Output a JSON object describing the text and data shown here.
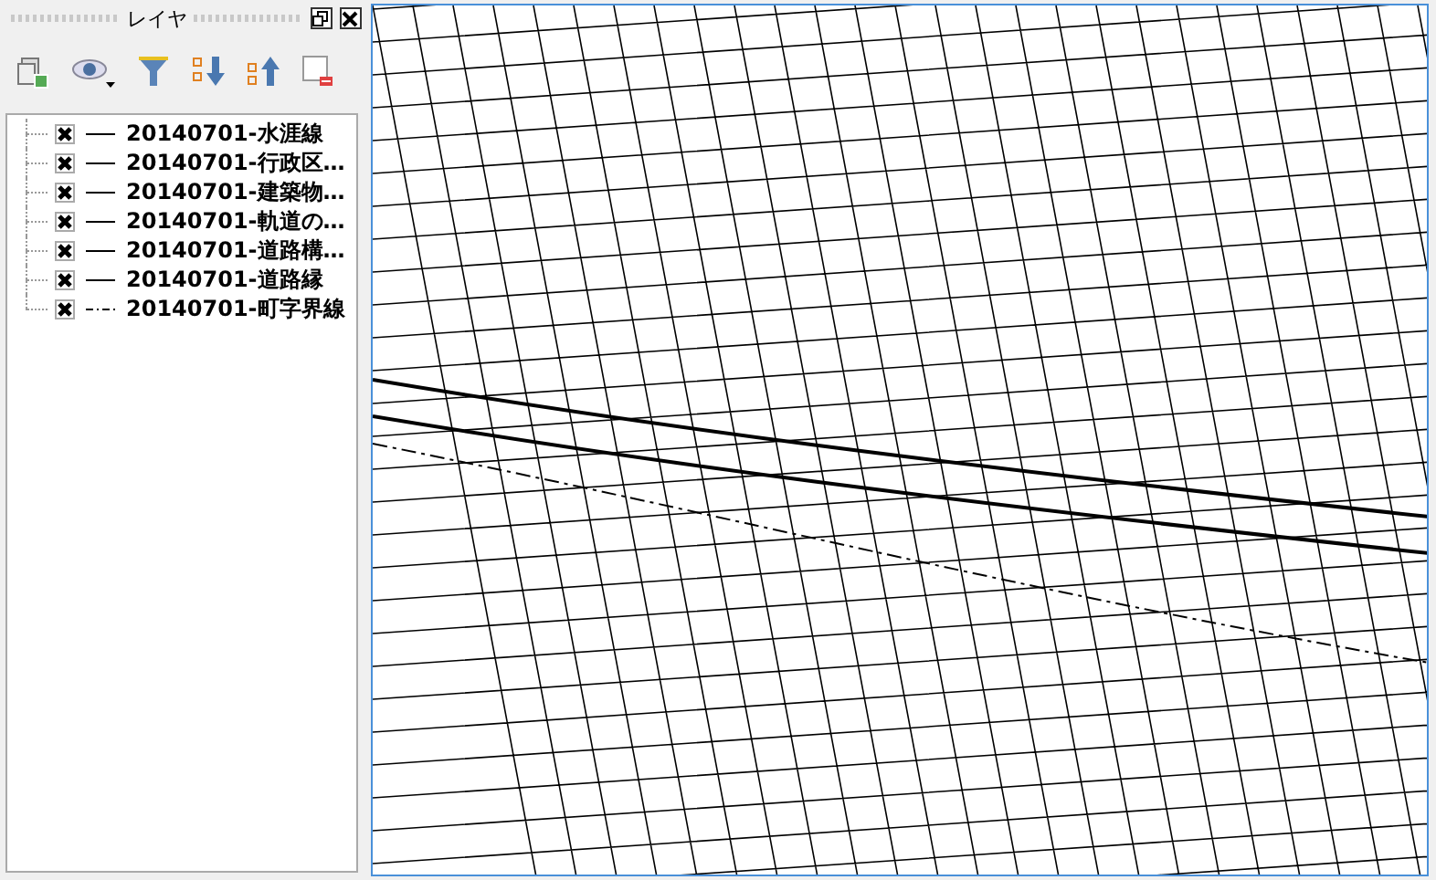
{
  "panel": {
    "title": "レイヤ"
  },
  "layers": [
    {
      "name": "20140701-水涯線",
      "checked": true,
      "kind": "solid"
    },
    {
      "name": "20140701-行政区…",
      "checked": true,
      "kind": "solid"
    },
    {
      "name": "20140701-建築物…",
      "checked": true,
      "kind": "solid"
    },
    {
      "name": "20140701-軌道の…",
      "checked": true,
      "kind": "solid"
    },
    {
      "name": "20140701-道路構…",
      "checked": true,
      "kind": "solid"
    },
    {
      "name": "20140701-道路縁",
      "checked": true,
      "kind": "solid"
    },
    {
      "name": "20140701-町字界線",
      "checked": true,
      "kind": "dashdot"
    }
  ]
}
